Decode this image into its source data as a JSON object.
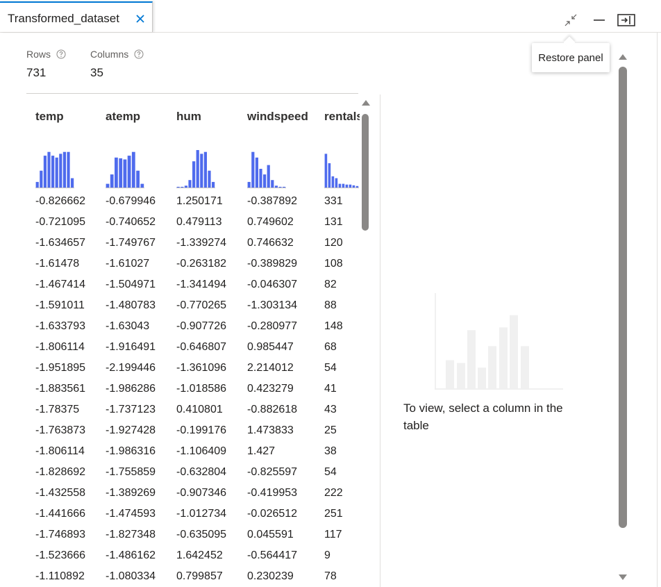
{
  "tab": {
    "title": "Transformed_dataset"
  },
  "tooltip": {
    "text": "Restore panel"
  },
  "stats": {
    "rows_label": "Rows",
    "rows_value": "731",
    "columns_label": "Columns",
    "columns_value": "35"
  },
  "table": {
    "columns": [
      "temp",
      "atemp",
      "hum",
      "windspeed",
      "rentals"
    ],
    "rows": [
      [
        "-0.826662",
        "-0.679946",
        "1.250171",
        "-0.387892",
        "331"
      ],
      [
        "-0.721095",
        "-0.740652",
        "0.479113",
        "0.749602",
        "131"
      ],
      [
        "-1.634657",
        "-1.749767",
        "-1.339274",
        "0.746632",
        "120"
      ],
      [
        "-1.61478",
        "-1.61027",
        "-0.263182",
        "-0.389829",
        "108"
      ],
      [
        "-1.467414",
        "-1.504971",
        "-1.341494",
        "-0.046307",
        "82"
      ],
      [
        "-1.591011",
        "-1.480783",
        "-0.770265",
        "-1.303134",
        "88"
      ],
      [
        "-1.633793",
        "-1.63043",
        "-0.907726",
        "-0.280977",
        "148"
      ],
      [
        "-1.806114",
        "-1.916491",
        "-0.646807",
        "0.985447",
        "68"
      ],
      [
        "-1.951895",
        "-2.199446",
        "-1.361096",
        "2.214012",
        "54"
      ],
      [
        "-1.883561",
        "-1.986286",
        "-1.018586",
        "0.423279",
        "41"
      ],
      [
        "-1.78375",
        "-1.737123",
        "0.410801",
        "-0.882618",
        "43"
      ],
      [
        "-1.763873",
        "-1.927428",
        "-0.199176",
        "1.473833",
        "25"
      ],
      [
        "-1.806114",
        "-1.986316",
        "-1.106409",
        "1.427",
        "38"
      ],
      [
        "-1.828692",
        "-1.755859",
        "-0.632804",
        "-0.825597",
        "54"
      ],
      [
        "-1.432558",
        "-1.389269",
        "-0.907346",
        "-0.419953",
        "222"
      ],
      [
        "-1.441666",
        "-1.474593",
        "-1.012734",
        "-0.026512",
        "251"
      ],
      [
        "-1.746893",
        "-1.827348",
        "-0.635095",
        "0.045591",
        "117"
      ],
      [
        "-1.523666",
        "-1.486162",
        "1.642452",
        "-0.564417",
        "9"
      ],
      [
        "-1.110892",
        "-1.080334",
        "0.799857",
        "0.230239",
        "78"
      ]
    ],
    "histograms": [
      [
        0.15,
        0.45,
        0.85,
        0.95,
        0.85,
        0.8,
        0.9,
        0.95,
        0.95,
        0.25
      ],
      [
        0.1,
        0.35,
        0.8,
        0.78,
        0.75,
        0.85,
        0.95,
        0.45,
        0.1
      ],
      [
        0.02,
        0.02,
        0.05,
        0.2,
        0.7,
        1.0,
        0.9,
        0.95,
        0.45,
        0.15
      ],
      [
        0.15,
        0.95,
        0.8,
        0.5,
        0.35,
        0.6,
        0.2,
        0.05,
        0.02,
        0.02
      ],
      [
        0.9,
        0.65,
        0.3,
        0.25,
        0.1,
        0.1,
        0.08,
        0.08,
        0.06,
        0.04
      ]
    ]
  },
  "empty_state": {
    "message": "To view, select a column in the table",
    "placeholder_bars": [
      0.3,
      0.27,
      0.62,
      0.22,
      0.45,
      0.65,
      0.78,
      0.45
    ]
  },
  "colors": {
    "accent": "#0078d4",
    "histogram": "#4f6bed",
    "placeholder": "#f0f0f0",
    "scrollbar": "#8a8886"
  },
  "icons": {
    "close": "close-icon",
    "restore": "restore-panel-icon",
    "minimize": "minimize-icon",
    "panel": "collapse-panel-icon",
    "help": "help-circle-icon"
  }
}
